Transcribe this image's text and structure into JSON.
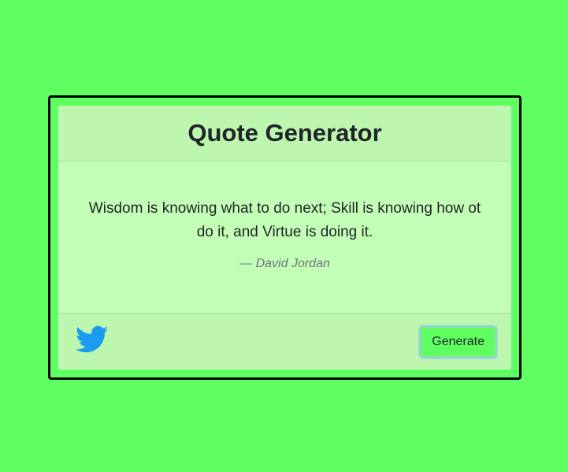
{
  "header": {
    "title": "Quote Generator"
  },
  "quote": {
    "text": "Wisdom is knowing what to do next; Skill is knowing how ot do it, and Virtue is doing it.",
    "author": "— David Jordan"
  },
  "footer": {
    "share_icon": "twitter-icon",
    "generate_label": "Generate"
  },
  "colors": {
    "page_background": "#5fff62",
    "card_background": "#c4ffb7",
    "header_footer_background": "#bcf6af",
    "twitter_blue": "#1d9bf0",
    "button_background": "#5fff62"
  }
}
